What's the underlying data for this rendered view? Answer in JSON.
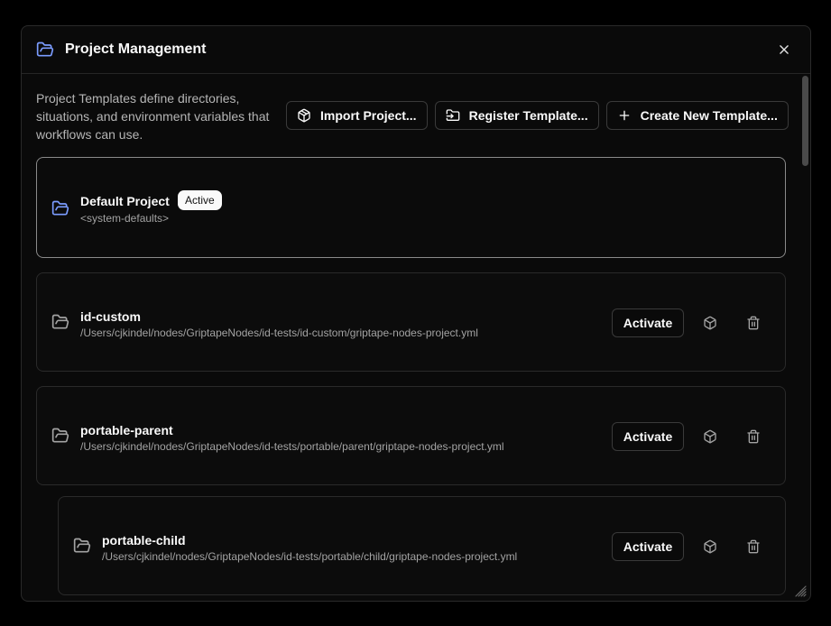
{
  "dialog": {
    "title": "Project Management",
    "title_icon": "folder-open-icon",
    "close_icon": "close-icon"
  },
  "description": "Project Templates define directories, situations, and environment variables that workflows can use.",
  "toolbar": {
    "import_label": "Import Project...",
    "import_icon": "package-icon",
    "register_label": "Register Template...",
    "register_icon": "folder-input-icon",
    "create_label": "Create New Template...",
    "create_icon": "plus-icon"
  },
  "projects": [
    {
      "name": "Default Project",
      "path": "<system-defaults>",
      "badge": "Active",
      "active": true
    },
    {
      "name": "id-custom",
      "path": "/Users/cjkindel/nodes/GriptapeNodes/id-tests/id-custom/griptape-nodes-project.yml",
      "action_label": "Activate",
      "active": false
    },
    {
      "name": "portable-parent",
      "path": "/Users/cjkindel/nodes/GriptapeNodes/id-tests/portable/parent/griptape-nodes-project.yml",
      "action_label": "Activate",
      "active": false
    },
    {
      "name": "portable-child",
      "path": "/Users/cjkindel/nodes/GriptapeNodes/id-tests/portable/child/griptape-nodes-project.yml",
      "action_label": "Activate",
      "active": false
    }
  ],
  "colors": {
    "accent_blue": "#7b9cff",
    "background": "#0a0a0a",
    "border": "#2a2a2a"
  }
}
